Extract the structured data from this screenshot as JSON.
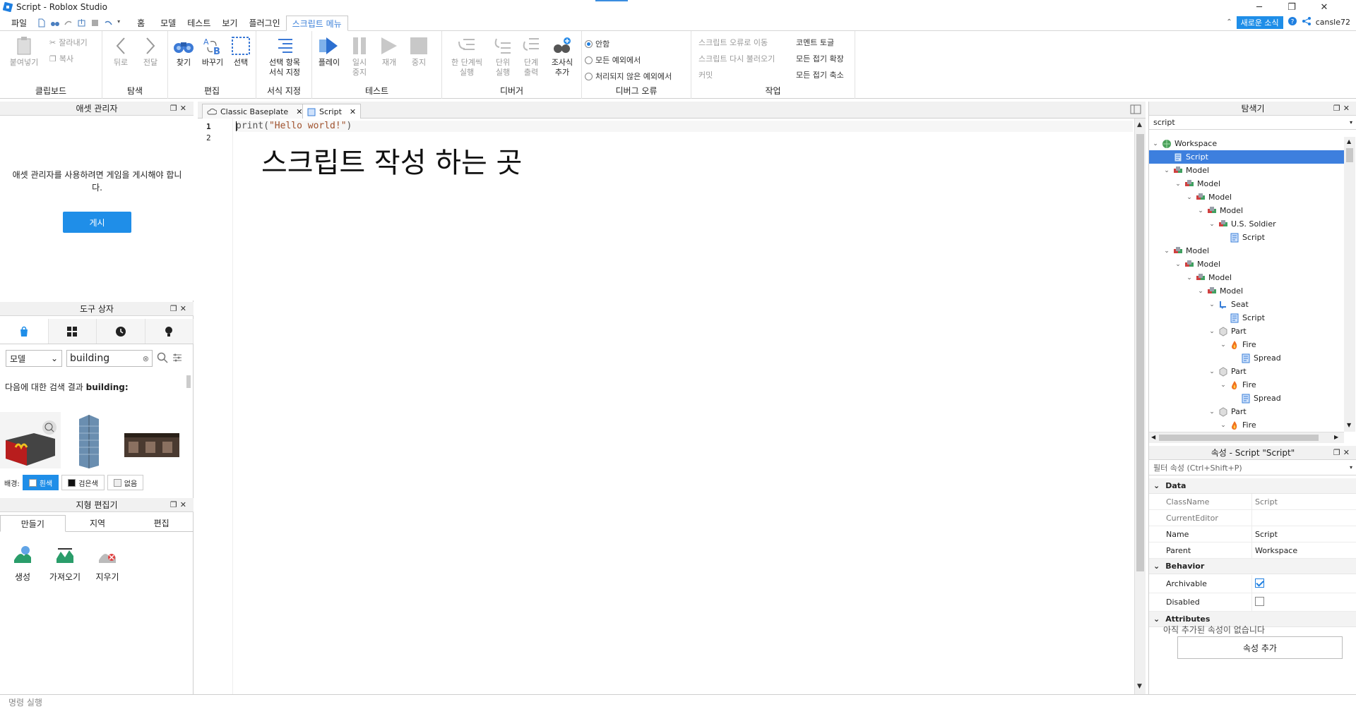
{
  "window": {
    "title": "Script - Roblox Studio",
    "minimize": "─",
    "maximize": "❐",
    "close": "✕"
  },
  "menu": {
    "items": [
      "파일",
      "홈",
      "모델",
      "테스트",
      "보기",
      "플러그인",
      "스크립트 메뉴"
    ],
    "news_button": "새로운 소식",
    "username": "cansle72"
  },
  "ribbon": {
    "clipboard": {
      "label": "클립보드",
      "paste": "붙여넣기",
      "cut": "잘라내기",
      "copy": "복사"
    },
    "navigate": {
      "label": "탐색",
      "back": "뒤로",
      "forward": "전달"
    },
    "edit": {
      "label": "편집",
      "find": "찾기",
      "replace": "바꾸기",
      "select": "선택"
    },
    "format": {
      "label": "서식 지정",
      "format_selection_1": "선택 항목",
      "format_selection_2": "서식 지정"
    },
    "test": {
      "label": "테스트",
      "play": "플레이",
      "pause_1": "일시",
      "pause_2": "중지",
      "resume": "재개",
      "stop": "중지"
    },
    "debugger": {
      "label": "디버거",
      "step_over_1": "한 단계씩",
      "step_over_2": "실행",
      "step_into_1": "단위",
      "step_into_2": "실행",
      "step_out_1": "단계",
      "step_out_2": "출력",
      "add_watch_1": "조사식",
      "add_watch_2": "추가"
    },
    "debug_errors": {
      "label": "디버그 오류",
      "never": "안함",
      "all_exceptions": "모든 예외에서",
      "unhandled": "처리되지 않은 예외에서"
    },
    "actions": {
      "label": "작업",
      "go_to_error": "스크립트 오류로 이동",
      "reload_script": "스크립트 다시 불러오기",
      "commit": "커밋",
      "toggle_comment": "코멘트 토글",
      "expand_all": "모든 접기 확장",
      "collapse_all": "모든 접기 축소"
    }
  },
  "asset_manager": {
    "title": "애셋 관리자",
    "message": "애셋 관리자를 사용하려면 게임을 게시해야 합니다.",
    "publish_button": "게시"
  },
  "toolbox": {
    "title": "도구 상자",
    "category": "모델",
    "search_value": "building",
    "results_prefix": "다음에 대한 검색 결과",
    "results_query": "building:",
    "background_label": "배경:",
    "bg_white": "흰색",
    "bg_black": "검은색",
    "bg_none": "없음"
  },
  "terrain": {
    "title": "지형 편집기",
    "tabs": [
      "만들기",
      "지역",
      "편집"
    ],
    "tools": [
      "생성",
      "가져오기",
      "지우기"
    ]
  },
  "editor": {
    "tabs": [
      "Classic Baseplate",
      "Script"
    ],
    "line_numbers": [
      "1",
      "2"
    ],
    "code_fn": "print",
    "code_open": "(",
    "code_string": "\"Hello world!\"",
    "code_close": ")",
    "annotation": "스크립트 작성 하는 곳"
  },
  "explorer": {
    "title": "탐색기",
    "filter": "script",
    "tree": [
      {
        "label": "Workspace",
        "depth": 0,
        "icon": "workspace",
        "chev": true
      },
      {
        "label": "Script",
        "depth": 1,
        "icon": "script",
        "chev": false,
        "selected": true
      },
      {
        "label": "Model",
        "depth": 1,
        "icon": "model",
        "chev": true
      },
      {
        "label": "Model",
        "depth": 2,
        "icon": "model",
        "chev": true
      },
      {
        "label": "Model",
        "depth": 3,
        "icon": "model",
        "chev": true
      },
      {
        "label": "Model",
        "depth": 4,
        "icon": "model",
        "chev": true
      },
      {
        "label": "U.S. Soldier",
        "depth": 5,
        "icon": "model",
        "chev": true
      },
      {
        "label": "Script",
        "depth": 6,
        "icon": "script",
        "chev": false
      },
      {
        "label": "Model",
        "depth": 1,
        "icon": "model",
        "chev": true
      },
      {
        "label": "Model",
        "depth": 2,
        "icon": "model",
        "chev": true
      },
      {
        "label": "Model",
        "depth": 3,
        "icon": "model",
        "chev": true
      },
      {
        "label": "Model",
        "depth": 4,
        "icon": "model",
        "chev": true
      },
      {
        "label": "Seat",
        "depth": 5,
        "icon": "seat",
        "chev": true
      },
      {
        "label": "Script",
        "depth": 6,
        "icon": "script",
        "chev": false
      },
      {
        "label": "Part",
        "depth": 5,
        "icon": "part",
        "chev": true
      },
      {
        "label": "Fire",
        "depth": 6,
        "icon": "fire",
        "chev": true
      },
      {
        "label": "Spread",
        "depth": 7,
        "icon": "script",
        "chev": false
      },
      {
        "label": "Part",
        "depth": 5,
        "icon": "part",
        "chev": true
      },
      {
        "label": "Fire",
        "depth": 6,
        "icon": "fire",
        "chev": true
      },
      {
        "label": "Spread",
        "depth": 7,
        "icon": "script",
        "chev": false
      },
      {
        "label": "Part",
        "depth": 5,
        "icon": "part",
        "chev": true
      },
      {
        "label": "Fire",
        "depth": 6,
        "icon": "fire",
        "chev": true
      }
    ]
  },
  "properties": {
    "title": "속성 - Script \"Script\"",
    "filter_placeholder": "필터 속성 (Ctrl+Shift+P)",
    "sections": {
      "data": "Data",
      "behavior": "Behavior",
      "attributes": "Attributes"
    },
    "rows": {
      "classname": {
        "name": "ClassName",
        "value": "Script"
      },
      "currenteditor": {
        "name": "CurrentEditor",
        "value": ""
      },
      "name": {
        "name": "Name",
        "value": "Script"
      },
      "parent": {
        "name": "Parent",
        "value": "Workspace"
      },
      "archivable": {
        "name": "Archivable",
        "checked": true
      },
      "disabled": {
        "name": "Disabled",
        "checked": false
      }
    },
    "no_attributes": "아직 추가된 속성이 없습니다",
    "add_attribute_button": "속성 추가"
  },
  "command_bar": {
    "placeholder": "명령 실행"
  },
  "colors": {
    "accent": "#1f8ee8",
    "selection": "#3d7fde"
  }
}
